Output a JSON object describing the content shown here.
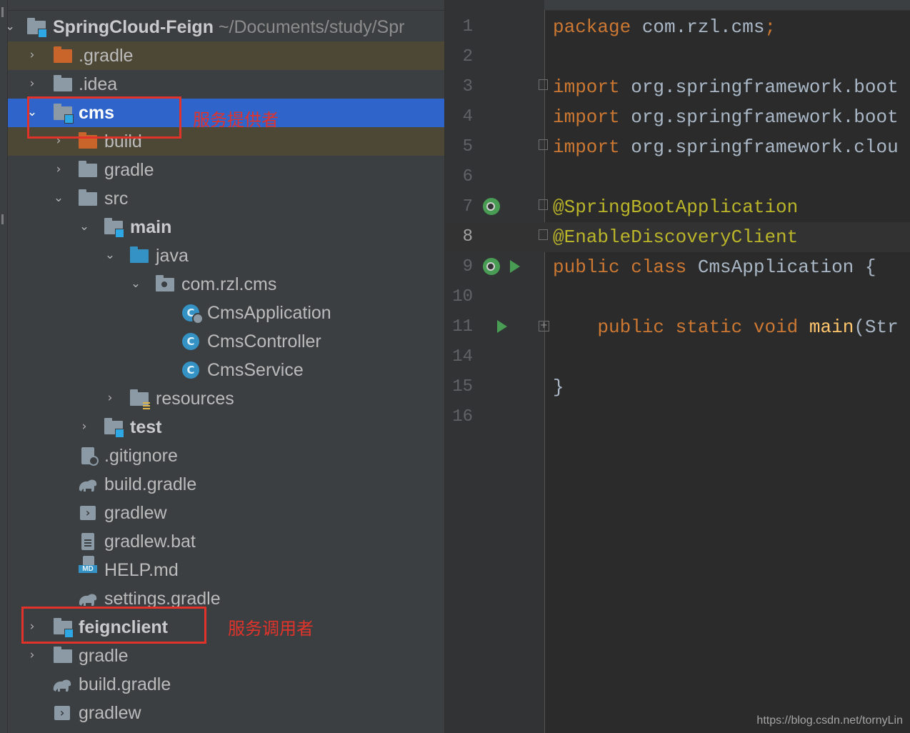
{
  "project": {
    "root": {
      "name": "SpringCloud-Feign",
      "path": "~/Documents/study/Spr"
    },
    "items": [
      {
        "label": ".gradle"
      },
      {
        "label": ".idea"
      },
      {
        "label": "cms"
      },
      {
        "label": "build"
      },
      {
        "label": "gradle"
      },
      {
        "label": "src"
      },
      {
        "label": "main"
      },
      {
        "label": "java"
      },
      {
        "label": "com.rzl.cms"
      },
      {
        "label": "CmsApplication"
      },
      {
        "label": "CmsController"
      },
      {
        "label": "CmsService"
      },
      {
        "label": "resources"
      },
      {
        "label": "test"
      },
      {
        "label": ".gitignore"
      },
      {
        "label": "build.gradle"
      },
      {
        "label": "gradlew"
      },
      {
        "label": "gradlew.bat"
      },
      {
        "label": "HELP.md"
      },
      {
        "label": "settings.gradle"
      },
      {
        "label": "feignclient"
      },
      {
        "label": "gradle"
      },
      {
        "label": "build.gradle"
      },
      {
        "label": "gradlew"
      }
    ],
    "class_icon_letter": "C",
    "md_icon_text": "MD",
    "terminal_icon_glyph": "›"
  },
  "annotations": {
    "provider": "服务提供者",
    "consumer": "服务调用者"
  },
  "editor": {
    "current_line": "8",
    "lines": [
      {
        "num": "1",
        "parts": [
          [
            "kw",
            "package"
          ],
          [
            "plain",
            " com.rzl.cms"
          ],
          [
            "kw",
            ";"
          ]
        ]
      },
      {
        "num": "2",
        "parts": []
      },
      {
        "num": "3",
        "parts": [
          [
            "kw",
            "import"
          ],
          [
            "plain",
            " org.springframework.boot"
          ]
        ]
      },
      {
        "num": "4",
        "parts": [
          [
            "kw",
            "import"
          ],
          [
            "plain",
            " org.springframework.boot"
          ]
        ]
      },
      {
        "num": "5",
        "parts": [
          [
            "kw",
            "import"
          ],
          [
            "plain",
            " org.springframework.clou"
          ]
        ]
      },
      {
        "num": "6",
        "parts": []
      },
      {
        "num": "7",
        "parts": [
          [
            "ann",
            "@SpringBootApplication"
          ]
        ]
      },
      {
        "num": "8",
        "parts": [
          [
            "ann",
            "@EnableDiscoveryClient"
          ]
        ]
      },
      {
        "num": "9",
        "parts": [
          [
            "kw",
            "public class"
          ],
          [
            "plain",
            " CmsApplication {"
          ]
        ]
      },
      {
        "num": "10",
        "parts": []
      },
      {
        "num": "11",
        "parts": [
          [
            "plain",
            "    "
          ],
          [
            "kw",
            "public static void"
          ],
          [
            "plain",
            " "
          ],
          [
            "fn",
            "main"
          ],
          [
            "plain",
            "(Str"
          ]
        ]
      },
      {
        "num": "14",
        "parts": []
      },
      {
        "num": "15",
        "parts": [
          [
            "plain",
            "}"
          ]
        ]
      },
      {
        "num": "16",
        "parts": []
      }
    ]
  },
  "watermark": "https://blog.csdn.net/tornyLin",
  "colors": {
    "panel_bg": "#3c3f41",
    "editor_bg": "#2b2b2b",
    "selection": "#2f65ca",
    "keyword": "#cc7832",
    "annotation": "#bbb529",
    "method": "#ffc66d",
    "annotation_box": "#e2332b"
  }
}
